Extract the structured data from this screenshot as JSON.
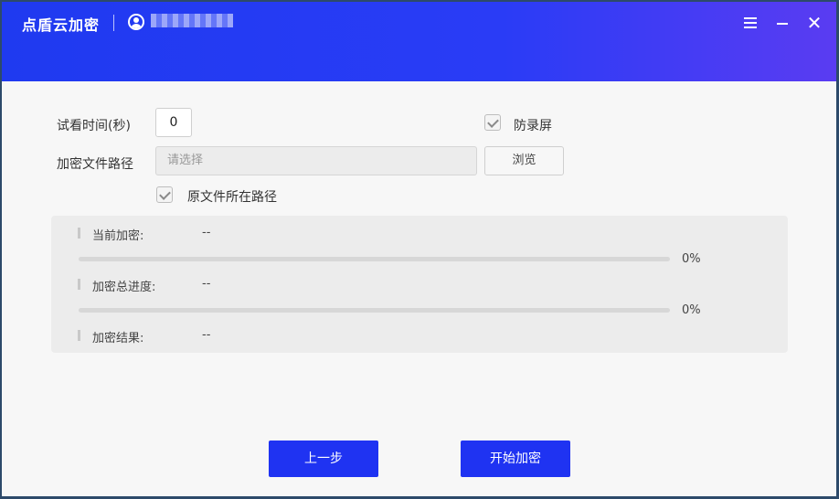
{
  "app": {
    "title": "点盾云加密",
    "username": ""
  },
  "trial_time": {
    "label": "试看时间(秒)",
    "value": "0"
  },
  "anti_record": {
    "label": "防录屏",
    "checked": true
  },
  "encrypt_path": {
    "label": "加密文件路径",
    "placeholder": "请选择",
    "browse_label": "浏览"
  },
  "original_path": {
    "label": "原文件所在路径",
    "checked": true
  },
  "progress_panel": {
    "current": {
      "label": "当前加密:",
      "value": "--",
      "percent_text": "0%",
      "percent": 0
    },
    "total": {
      "label": "加密总进度:",
      "value": "--",
      "percent_text": "0%",
      "percent": 0
    },
    "result": {
      "label": "加密结果:",
      "value": "--"
    }
  },
  "buttons": {
    "prev": "上一步",
    "start": "开始加密"
  },
  "colors": {
    "accent": "#1f33f2",
    "header_start": "#1f3af0",
    "header_end": "#5a3cf2"
  },
  "icons": [
    "user-icon",
    "menu-icon",
    "minimize-icon",
    "close-icon",
    "check-icon"
  ]
}
